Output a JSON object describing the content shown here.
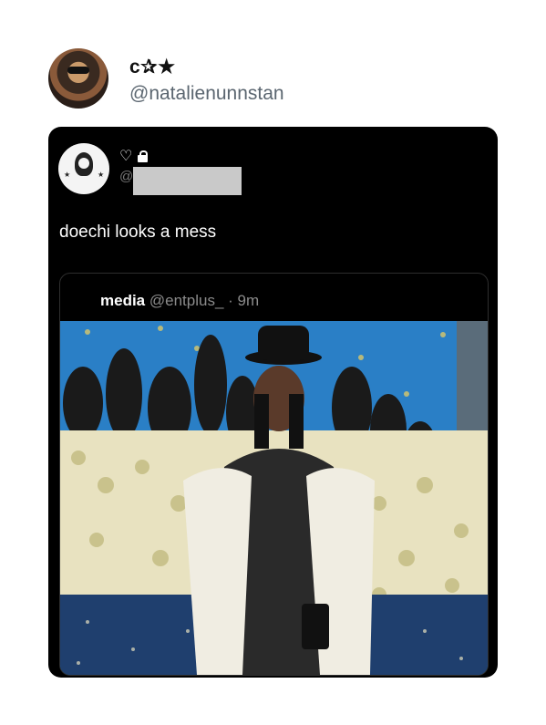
{
  "author": {
    "display_name": "c✰★",
    "handle": "@natalienunnstan"
  },
  "quoted": {
    "handle_prefix": "@",
    "text": "doechi looks a mess",
    "icons": [
      "heart-icon",
      "lock-icon"
    ]
  },
  "embed": {
    "source_name": "media",
    "source_handle": "@entplus_",
    "time": "· 9m"
  },
  "colors": {
    "card_bg": "#000000",
    "handle_gray": "#5b6670",
    "backdrop_blue": "#2a7fc6"
  }
}
